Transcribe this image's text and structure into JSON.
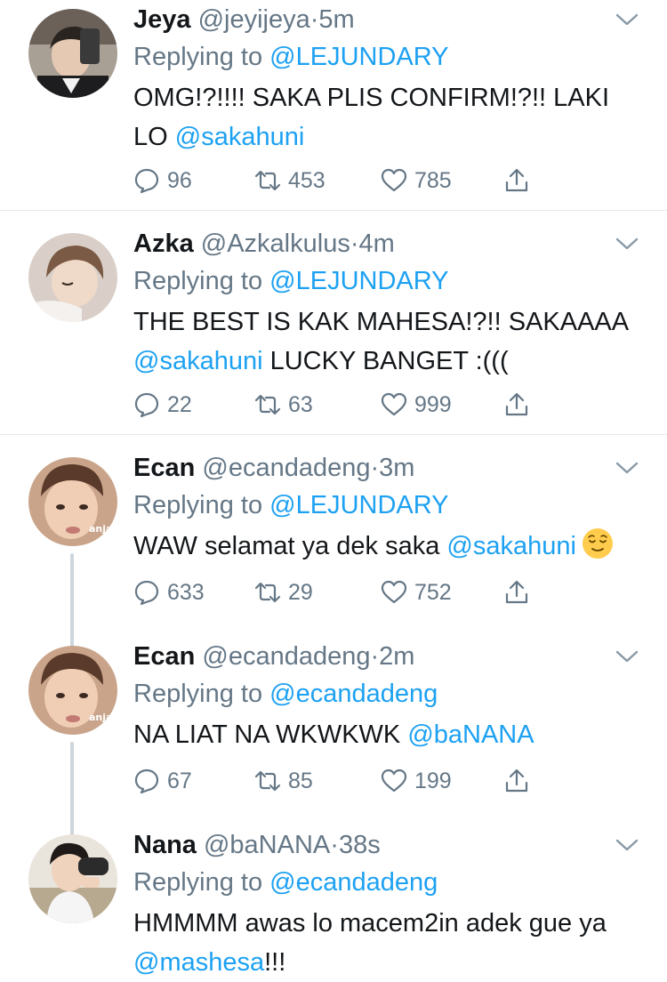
{
  "tweets": [
    {
      "name": "Jeya",
      "handle": "@jeyijeya",
      "time": "5m",
      "replying_label": "Replying to",
      "replying_to": "@LEJUNDARY",
      "text_before": "OMG!?!!!! SAKA PLIS CONFIRM!?!! LAKI LO ",
      "mention": "@sakahuni",
      "text_after": "",
      "replies": "96",
      "retweets": "453",
      "likes": "785"
    },
    {
      "name": "Azka",
      "handle": "@Azkalkulus",
      "time": "4m",
      "replying_label": "Replying to",
      "replying_to": "@LEJUNDARY",
      "text_before": "THE BEST IS KAK MAHESA!?!! SAKAAAA ",
      "mention": "@sakahuni",
      "text_after": " LUCKY BANGET :(((",
      "replies": "22",
      "retweets": "63",
      "likes": "999"
    },
    {
      "name": "Ecan",
      "handle": "@ecandadeng",
      "time": "3m",
      "replying_label": "Replying to",
      "replying_to": "@LEJUNDARY",
      "text_before": "WAW selamat ya dek saka ",
      "mention": "@sakahuni",
      "text_after": "",
      "emoji": "relieved-face",
      "replies": "633",
      "retweets": "29",
      "likes": "752"
    },
    {
      "name": "Ecan",
      "handle": "@ecandadeng",
      "time": "2m",
      "replying_label": "Replying to",
      "replying_to": "@ecandadeng",
      "text_before": "NA LIAT NA WKWKWK ",
      "mention": "@baNANA",
      "text_after": "",
      "replies": "67",
      "retweets": "85",
      "likes": "199"
    },
    {
      "name": "Nana",
      "handle": "@baNANA",
      "time": "38s",
      "replying_label": "Replying to",
      "replying_to": "@ecandadeng",
      "text_before": "HMMMM awas lo macem2in adek gue ya ",
      "mention": "@mashesa",
      "text_after": "!!!"
    }
  ],
  "avatar_label": "anjay",
  "dot": "·",
  "colors": {
    "accent": "#1da1f2",
    "muted": "#657786",
    "text": "#14171a",
    "divider": "#e1e8ed"
  }
}
